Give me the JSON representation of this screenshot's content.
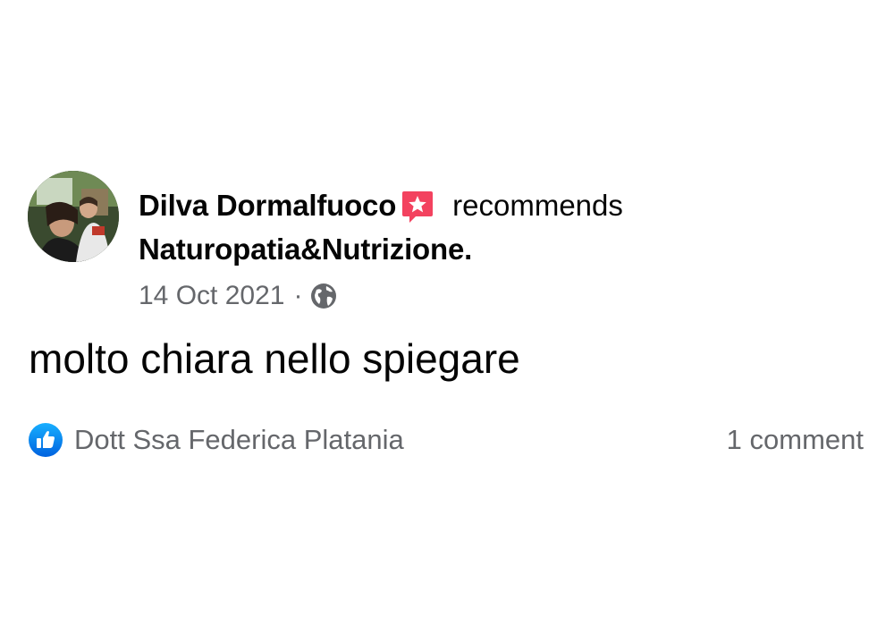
{
  "post": {
    "author_name": "Dilva Dormalfuoco",
    "action": "recommends",
    "page_name": "Naturopatia&Nutrizione.",
    "date": "14 Oct 2021",
    "separator": "·",
    "visibility_icon": "globe-icon",
    "recommend_icon": "star-speech-bubble-icon",
    "text": "molto chiara nello spiegare"
  },
  "reactions": {
    "icon": "like-thumb-icon",
    "reactor_name": "Dott Ssa Federica Platania",
    "comment_count": "1 comment"
  },
  "colors": {
    "text_primary": "#050505",
    "text_secondary": "#65676b",
    "recommend_badge": "#f3425f",
    "like_blue": "#1877f2"
  }
}
